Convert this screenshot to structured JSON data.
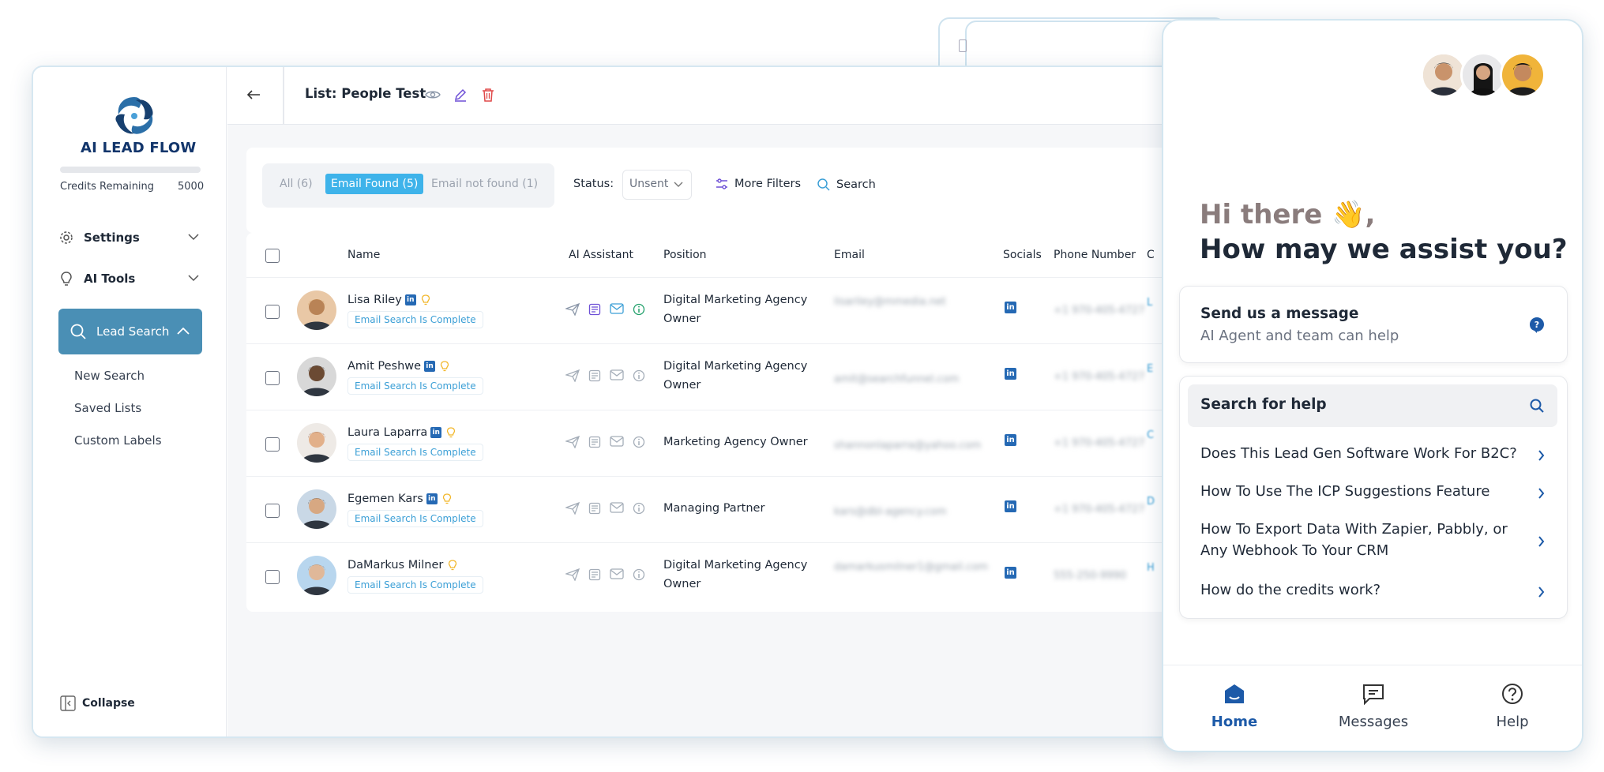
{
  "brand": {
    "name": "AI LEAD FLOW"
  },
  "credits": {
    "label": "Credits Remaining",
    "value": "5000"
  },
  "sidebar": {
    "settings": "Settings",
    "ai_tools": "AI Tools",
    "lead_search": "Lead Search",
    "sub_items": [
      "New Search",
      "Saved Lists",
      "Custom Labels"
    ],
    "collapse": "Collapse"
  },
  "header": {
    "list_title": "List: People Test"
  },
  "filters": {
    "all": "All (6)",
    "email_found": "Email Found (5)",
    "email_not_found": "Email not found (1)",
    "status_label": "Status:",
    "status_value": "Unsent",
    "more_filters": "More Filters",
    "search": "Search"
  },
  "table": {
    "columns": [
      "Name",
      "AI Assistant",
      "Position",
      "Email",
      "Socials",
      "Phone Number",
      "C"
    ],
    "rows": [
      {
        "name": "Lisa Riley",
        "status": "Email Search Is Complete",
        "position": "Digital Marketing Agency Owner",
        "email": "lisariley@mmedia.net",
        "phone": "+1 970-405-4727",
        "company": "L"
      },
      {
        "name": "Amit Peshwe",
        "status": "Email Search Is Complete",
        "position": "Digital Marketing Agency Owner",
        "email": "amit@searchfunnel.com",
        "phone": "+1 970-405-4727",
        "company": "E"
      },
      {
        "name": "Laura Laparra",
        "status": "Email Search Is Complete",
        "position": "Marketing Agency Owner",
        "email": "shannonlaparra@yahoo.com",
        "phone": "+1 970-405-4727",
        "company": "C"
      },
      {
        "name": "Egemen Kars",
        "status": "Email Search Is Complete",
        "position": "Managing Partner",
        "email": "kars@dbl-agency.com",
        "phone": "+1 970-405-4727",
        "company": "D"
      },
      {
        "name": "DaMarkus Milner",
        "status": "Email Search Is Complete",
        "position": "Digital Marketing Agency Owner",
        "email": "damarkusmilner1@gmail.com",
        "phone": "555-250-9990",
        "company": "H"
      }
    ]
  },
  "widget": {
    "greeting": "Hi there 👋,",
    "headline": "How may we assist you?",
    "message_title": "Send us a message",
    "message_sub": "AI Agent and team can help",
    "search_help": "Search for help",
    "help_items": [
      "Does This Lead Gen Software Work For B2C?",
      "How To Use The ICP Suggestions Feature",
      "How To Export Data With Zapier, Pabbly, or Any Webhook To Your CRM",
      "How do the credits work?"
    ],
    "tabs": {
      "home": "Home",
      "messages": "Messages",
      "help": "Help"
    }
  },
  "colors": {
    "accent": "#3eb3ea",
    "sidebar_active": "#4a8fb5",
    "widget_active": "#1d5aa8",
    "linkedin": "#2569b4"
  }
}
